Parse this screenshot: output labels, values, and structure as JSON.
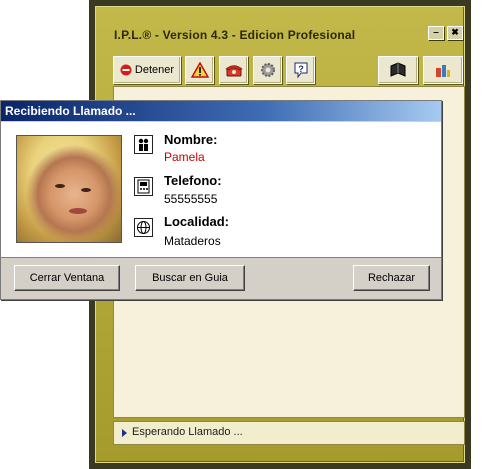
{
  "main_window": {
    "title": "I.P.L.® - Version 4.3 - Edicion Profesional",
    "minimize_label": "‒",
    "close_label": "✖"
  },
  "toolbar": {
    "stop_label": "Detener",
    "buttons": [
      {
        "icon": "stop-icon"
      },
      {
        "icon": "warning-icon"
      },
      {
        "icon": "phone-icon"
      },
      {
        "icon": "gear-icon"
      },
      {
        "icon": "help-icon"
      },
      {
        "icon": "book-icon"
      },
      {
        "icon": "tools-icon"
      }
    ]
  },
  "status": {
    "text": "Esperando Llamado ..."
  },
  "popup": {
    "title": "Recibiendo Llamado ...",
    "fields": {
      "name_label": "Nombre:",
      "name_value": "Pamela",
      "phone_label": "Telefono:",
      "phone_value": "55555555",
      "city_label": "Localidad:",
      "city_value": "Mataderos"
    },
    "buttons": {
      "close": "Cerrar Ventana",
      "search": "Buscar en Guia",
      "reject": "Rechazar"
    },
    "colors": {
      "name_value": "#cc0000",
      "title_bar": "#0a246a"
    }
  }
}
